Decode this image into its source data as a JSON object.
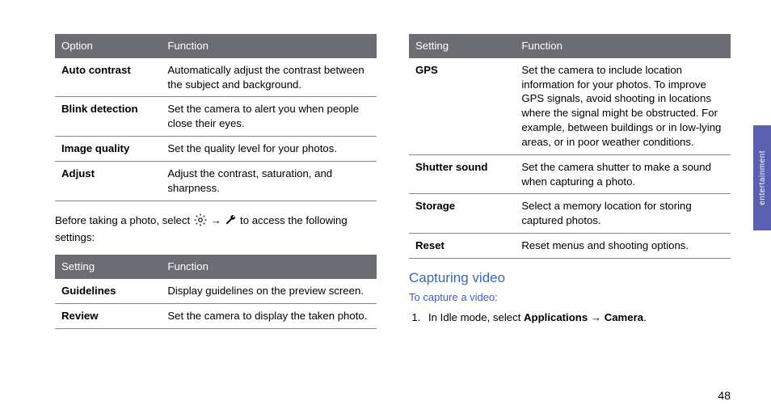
{
  "sideTab": "entertainment",
  "pageNumber": "48",
  "left": {
    "table1": {
      "head": {
        "c1": "Option",
        "c2": "Function"
      },
      "rows": [
        {
          "c1": "Auto contrast",
          "c2": "Automatically adjust the contrast between the subject and background."
        },
        {
          "c1": "Blink detection",
          "c2": "Set the camera to alert you when people close their eyes."
        },
        {
          "c1": "Image quality",
          "c2": "Set the quality level for your photos."
        },
        {
          "c1": "Adjust",
          "c2": "Adjust the contrast, saturation, and sharpness."
        }
      ]
    },
    "para_pre": "Before taking a photo, select ",
    "para_mid": " → ",
    "para_post": " to access the following settings:",
    "table2": {
      "head": {
        "c1": "Setting",
        "c2": "Function"
      },
      "rows": [
        {
          "c1": "Guidelines",
          "c2": "Display guidelines on the preview screen."
        },
        {
          "c1": "Review",
          "c2": "Set the camera to display the taken photo."
        }
      ]
    }
  },
  "right": {
    "table": {
      "head": {
        "c1": "Setting",
        "c2": "Function"
      },
      "rows": [
        {
          "c1": "GPS",
          "c2": "Set the camera to include location information for your photos.\nTo improve GPS signals, avoid shooting in locations where the signal might be obstructed. For example, between buildings or in low-lying areas, or in poor weather conditions."
        },
        {
          "c1": "Shutter sound",
          "c2": "Set the camera shutter to make a sound when capturing a photo."
        },
        {
          "c1": "Storage",
          "c2": "Select a memory location for storing captured photos."
        },
        {
          "c1": "Reset",
          "c2": "Reset menus and shooting options."
        }
      ]
    },
    "heading": "Capturing video",
    "subhead": "To capture a video:",
    "step_pre": "In Idle mode, select ",
    "step_app": "Applications",
    "step_arrow": " → ",
    "step_cam": "Camera",
    "step_dot": "."
  }
}
